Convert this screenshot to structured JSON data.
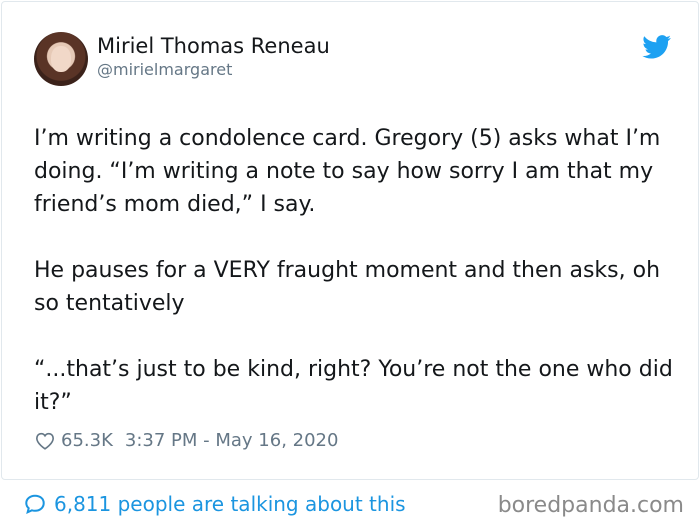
{
  "author": {
    "display_name": "Miriel Thomas Reneau",
    "handle": "@mirielmargaret",
    "avatar_icon": "user-avatar"
  },
  "brand": {
    "icon": "twitter-bird-icon",
    "color": "#1da1f2"
  },
  "tweet": {
    "paragraphs": [
      "I’m writing a condolence card. Gregory (5) asks what I’m doing. “I’m writing a note to say how sorry I am that my friend’s mom died,” I say.",
      "He pauses for a VERY fraught moment and then asks, oh so tentatively",
      "“...that’s just to be kind, right? You’re not the one who did it?”"
    ]
  },
  "meta": {
    "likes": "65.3K",
    "time": "3:37 PM - May 16, 2020"
  },
  "footer": {
    "talking_text": "6,811 people are talking about this",
    "accent": "#1b95e0"
  },
  "watermark": "boredpanda.com"
}
